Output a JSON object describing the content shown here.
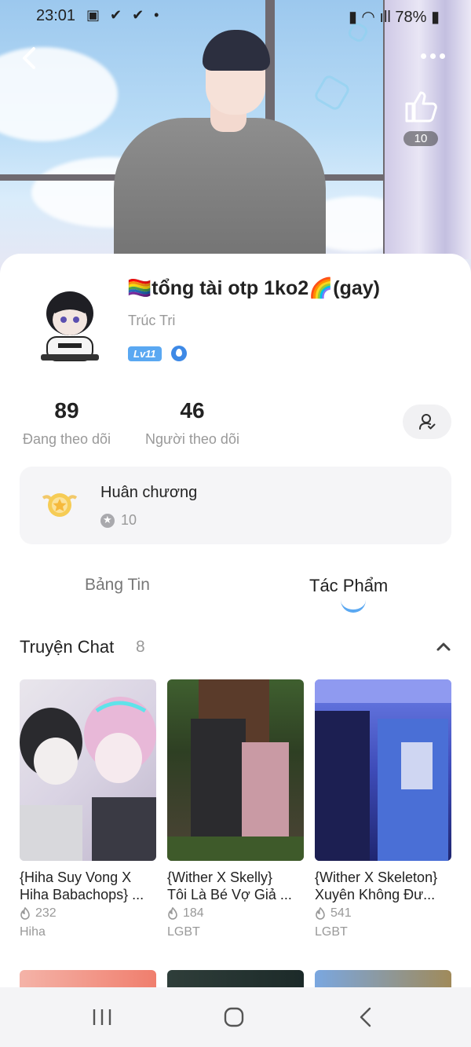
{
  "status_bar": {
    "time": "23:01",
    "notif_icons": "▣ ✔ ✔ •",
    "battery": "78%"
  },
  "hero": {
    "like_count": "10"
  },
  "profile": {
    "name": "🏳️‍🌈tổng tài otp 1ko2🌈(gay)",
    "subname": "Trúc Tri",
    "level": "Lv11"
  },
  "stats": {
    "following_count": "89",
    "following_label": "Đang theo dõi",
    "followers_count": "46",
    "followers_label": "Người theo dõi"
  },
  "medal": {
    "title": "Huân chương",
    "count": "10"
  },
  "tabs": {
    "feed": "Bảng Tin",
    "works": "Tác Phẩm"
  },
  "section": {
    "title": "Truyện Chat",
    "count": "8"
  },
  "stories": [
    {
      "line1": "{Hiha Suy Vong X",
      "line2": "Hiha Babachops} ...",
      "views": "232",
      "tag": "Hiha"
    },
    {
      "line1": "{Wither X Skelly}",
      "line2": "Tôi Là Bé Vợ Giả ...",
      "views": "184",
      "tag": "LGBT"
    },
    {
      "line1": "{Wither X Skeleton}",
      "line2": "Xuyên Không Đư...",
      "views": "541",
      "tag": "LGBT"
    }
  ],
  "colors": {
    "accent": "#5aa8f2",
    "muted_text": "#999999",
    "card_bg": "#f5f5f7"
  }
}
